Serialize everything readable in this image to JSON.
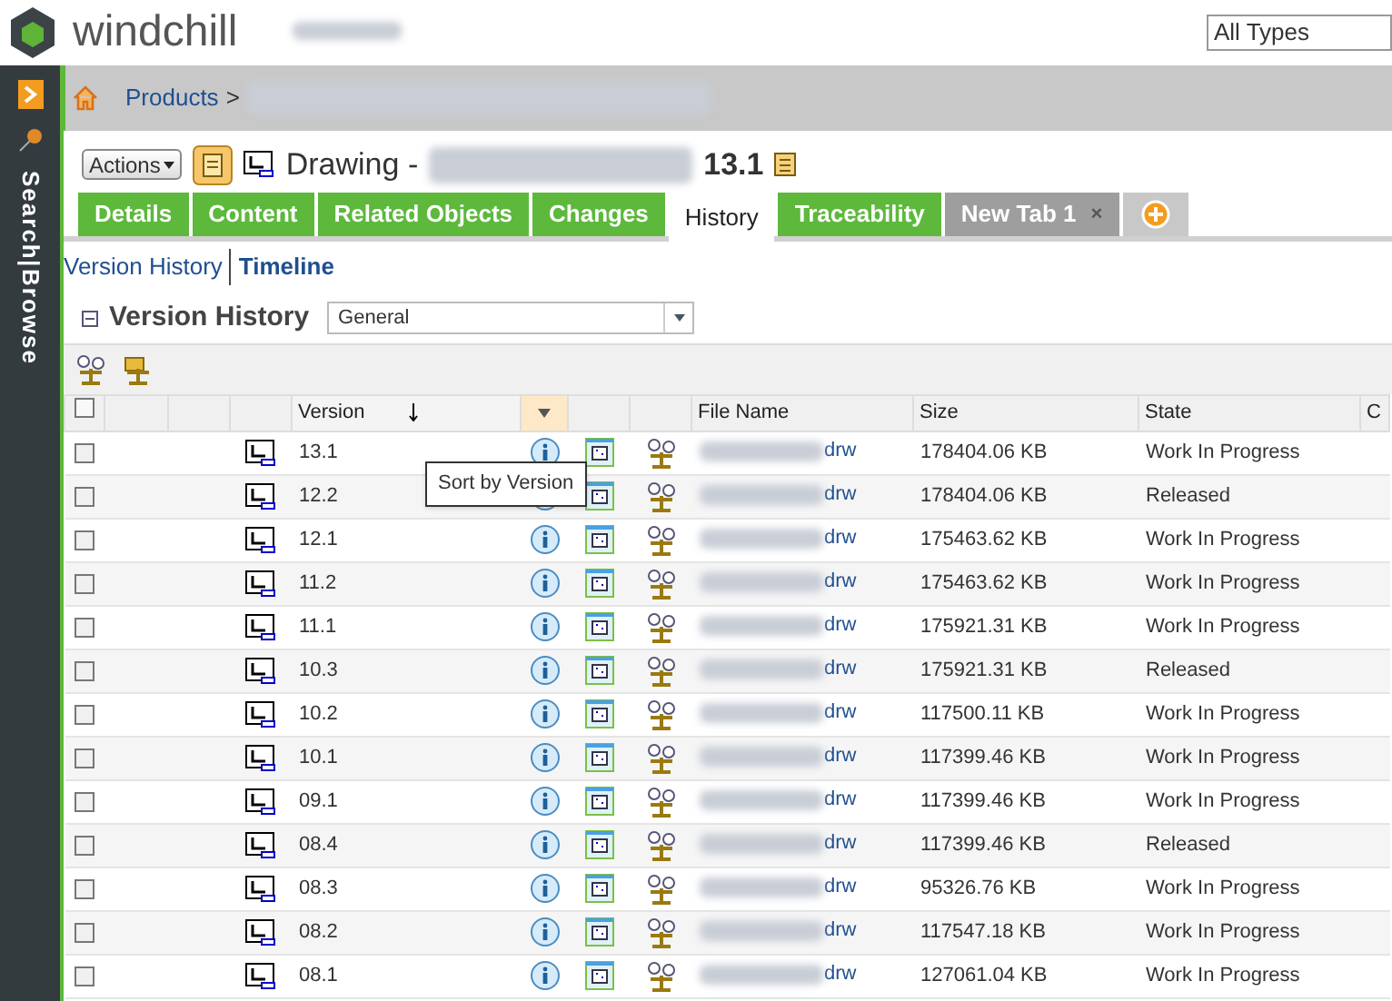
{
  "header": {
    "brand": "windchill",
    "type_select": "All Types"
  },
  "sidebar": {
    "links": [
      "Search",
      "|",
      "Browse"
    ]
  },
  "breadcrumb": {
    "root": "Products",
    "separator": ">"
  },
  "object": {
    "actions": "Actions",
    "title": "Drawing -",
    "version": "13.1"
  },
  "tabs": [
    {
      "label": "Details",
      "selected": false,
      "kind": "tab"
    },
    {
      "label": "Content",
      "selected": false,
      "kind": "tab"
    },
    {
      "label": "Related Objects",
      "selected": false,
      "kind": "tab"
    },
    {
      "label": "Changes",
      "selected": false,
      "kind": "tab"
    },
    {
      "label": "History",
      "selected": true,
      "kind": "tab"
    },
    {
      "label": "Traceability",
      "selected": false,
      "kind": "tab"
    },
    {
      "label": "New Tab 1",
      "selected": false,
      "kind": "custom",
      "close": "×"
    }
  ],
  "sub_links": [
    {
      "label": "Version History",
      "selected": true
    },
    {
      "label": "Timeline",
      "selected": false
    }
  ],
  "panel": {
    "title": "Version History",
    "view": "General"
  },
  "table": {
    "columns": [
      "Version",
      "File Name",
      "Size",
      "State",
      "C"
    ],
    "tooltip": "Sort by Version",
    "select_all": {
      "checked": false
    },
    "rows": [
      {
        "checked": false,
        "version": "13.1",
        "file": "drw",
        "size": "178404.06 KB",
        "state": "Work In Progress"
      },
      {
        "checked": false,
        "version": "12.2",
        "file": "drw",
        "size": "178404.06 KB",
        "state": "Released"
      },
      {
        "checked": false,
        "version": "12.1",
        "file": "drw",
        "size": "175463.62 KB",
        "state": "Work In Progress"
      },
      {
        "checked": false,
        "version": "11.2",
        "file": "drw",
        "size": "175463.62 KB",
        "state": "Work In Progress"
      },
      {
        "checked": false,
        "version": "11.1",
        "file": "drw",
        "size": "175921.31 KB",
        "state": "Work In Progress"
      },
      {
        "checked": false,
        "version": "10.3",
        "file": "drw",
        "size": "175921.31 KB",
        "state": "Released"
      },
      {
        "checked": false,
        "version": "10.2",
        "file": "drw",
        "size": "117500.11 KB",
        "state": "Work In Progress"
      },
      {
        "checked": false,
        "version": "10.1",
        "file": "drw",
        "size": "117399.46 KB",
        "state": "Work In Progress"
      },
      {
        "checked": false,
        "version": "09.1",
        "file": "drw",
        "size": "117399.46 KB",
        "state": "Work In Progress"
      },
      {
        "checked": false,
        "version": "08.4",
        "file": "drw",
        "size": "117399.46 KB",
        "state": "Released"
      },
      {
        "checked": false,
        "version": "08.3",
        "file": "drw",
        "size": "95326.76 KB",
        "state": "Work In Progress"
      },
      {
        "checked": false,
        "version": "08.2",
        "file": "drw",
        "size": "117547.18 KB",
        "state": "Work In Progress"
      },
      {
        "checked": false,
        "version": "08.1",
        "file": "drw",
        "size": "127061.04 KB",
        "state": "Work In Progress"
      }
    ]
  }
}
